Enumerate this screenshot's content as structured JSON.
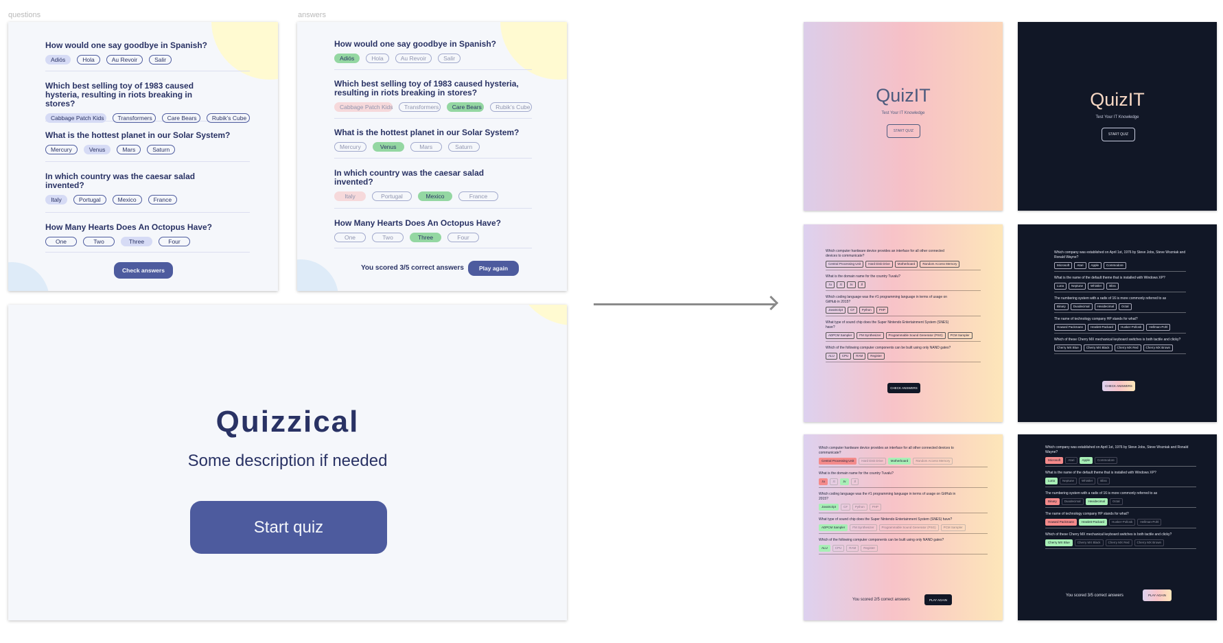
{
  "labels": {
    "questions": "questions",
    "answers": "answers"
  },
  "wireframe": {
    "questions": [
      {
        "text": "How would one say goodbye in Spanish?",
        "options": [
          "Adiós",
          "Hola",
          "Au Revoir",
          "Salir"
        ]
      },
      {
        "text": "Which best selling toy of 1983 caused hysteria, resulting in riots breaking in stores?",
        "options": [
          "Cabbage Patch Kids",
          "Transformers",
          "Care Bears",
          "Rubik’s Cube"
        ]
      },
      {
        "text": "What is the hottest planet in our Solar System?",
        "options": [
          "Mercury",
          "Venus",
          "Mars",
          "Saturn"
        ]
      },
      {
        "text": "In which country was the caesar salad invented?",
        "options": [
          "Italy",
          "Portugal",
          "Mexico",
          "France"
        ]
      },
      {
        "text": "How Many Hearts Does An Octopus Have?",
        "options": [
          "One",
          "Two",
          "Three",
          "Four"
        ]
      }
    ],
    "check_button": "Check answers",
    "score_text": "You scored 3/5 correct answers",
    "play_again": "Play again",
    "start": {
      "title": "Quizzical",
      "description": "Some description if needed",
      "button": "Start quiz"
    }
  },
  "designs": {
    "cover": {
      "title": "QuizIT",
      "subtitle": "Test Your IT Knowledge",
      "button": "START QUIZ"
    },
    "light_questions": [
      {
        "text": "Which computer hardware device provides an interface for all other connected devices to communicate?",
        "options": [
          "Central Processing Unit",
          "Hard Disk Drive",
          "Motherboard",
          "Random Access Memory"
        ]
      },
      {
        "text": "What is the domain name for the country Tuvalu?",
        "options": [
          ".tu",
          ".tt",
          ".tv",
          ".tl"
        ]
      },
      {
        "text": "Which coding language was the #1 programming language in terms of usage on GitHub in 2015?",
        "options": [
          "JavaScript",
          "C#",
          "Python",
          "PHP"
        ]
      },
      {
        "text": "What type of sound chip does the Super Nintendo Entertainment System (SNES) have?",
        "options": [
          "ADPCM Sampler",
          "FM Synthesizer",
          "Programmable Sound Generator (PSG)",
          "PCM Sampler"
        ]
      },
      {
        "text": "Which of the following computer components can be built using only NAND gates?",
        "options": [
          "ALU",
          "CPU",
          "RAM",
          "Register"
        ]
      }
    ],
    "dark_questions": [
      {
        "text": "Which company was established on April 1st, 1976 by Steve Jobs, Steve Wozniak and Ronald Wayne?",
        "options": [
          "Microsoft",
          "Atari",
          "Apple",
          "Commodore"
        ]
      },
      {
        "text": "What is the name of the default theme that is installed with Windows XP?",
        "options": [
          "Luna",
          "Neptune",
          "Whistler",
          "Bliss"
        ]
      },
      {
        "text": "The numbering system with a radix of 16 is more commonly referred to as",
        "options": [
          "Binary",
          "Duodecimal",
          "Hexidecimal",
          "Octal"
        ]
      },
      {
        "text": "The name of technology company HP stands for what?",
        "options": [
          "Howard Packmann",
          "Hewlett-Packard",
          "Husker-Pollosk",
          "Hellman-Pohl"
        ]
      },
      {
        "text": "Which of these Cherry MX mechanical keyboard switches is both tactile and clicky?",
        "options": [
          "Cherry MX Blue",
          "Cherry MX Black",
          "Cherry MX Red",
          "Cherry MX Brown"
        ]
      }
    ],
    "check_button": "CHECK ANSWERS",
    "light_score": "You scored 2/5 correct answers",
    "dark_score": "You scored 3/5 correct answers",
    "play_again": "PLAY AGAIN"
  },
  "colors": {
    "primary": "#4d5b9e",
    "text": "#293264",
    "correct": "#94d7a2",
    "wrong": "#f8bcbc",
    "dark_bg": "#111726"
  }
}
